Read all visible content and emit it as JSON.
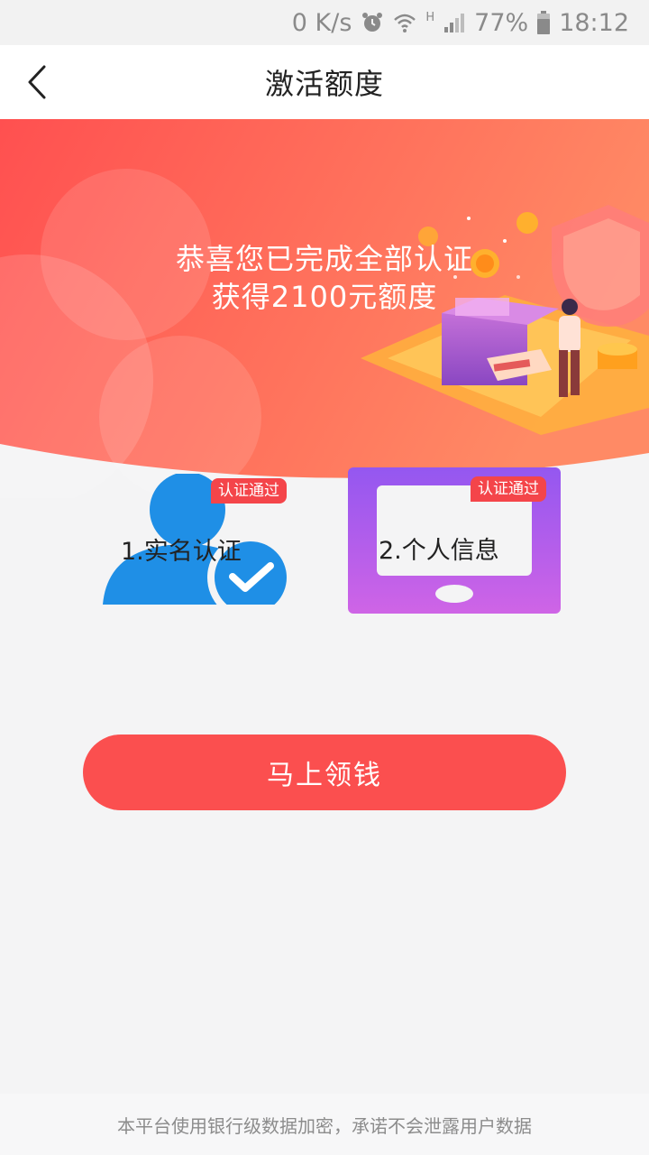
{
  "status_bar": {
    "network_speed": "0 K/s",
    "network_type": "H",
    "battery_percent": "77%",
    "time": "18:12"
  },
  "nav": {
    "title": "激活额度"
  },
  "banner": {
    "line1": "恭喜您已完成全部认证",
    "line2": "获得2100元额度"
  },
  "cards": [
    {
      "label": "1.实名认证",
      "badge": "认证通过"
    },
    {
      "label": "2.个人信息",
      "badge": "认证通过"
    }
  ],
  "cta": {
    "label": "马上领钱"
  },
  "footer": {
    "note": "本平台使用银行级数据加密，承诺不会泄露用户数据"
  },
  "colors": {
    "accent": "#fb4f4f",
    "badge": "#f4454a",
    "idcard_blue": "#1f8fe6",
    "personal_purple": "#9b5cf0"
  }
}
